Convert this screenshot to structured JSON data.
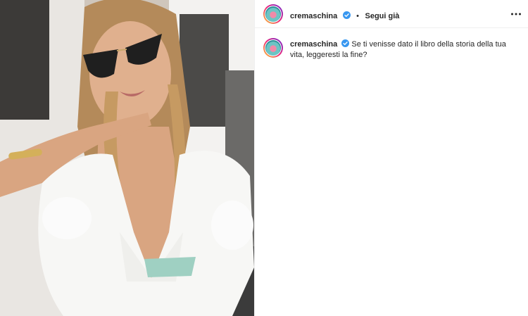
{
  "post": {
    "username": "cremaschina",
    "separator": "•",
    "follow_label": "Segui già",
    "more_icon": "more-horizontal-icon",
    "verified_icon": "verified-badge-icon",
    "caption": "Se ti venisse dato il libro della storia della tua vita, leggeresti la fine?"
  },
  "colors": {
    "verified": "#3897f0",
    "text": "#262626",
    "border": "#efefef"
  }
}
